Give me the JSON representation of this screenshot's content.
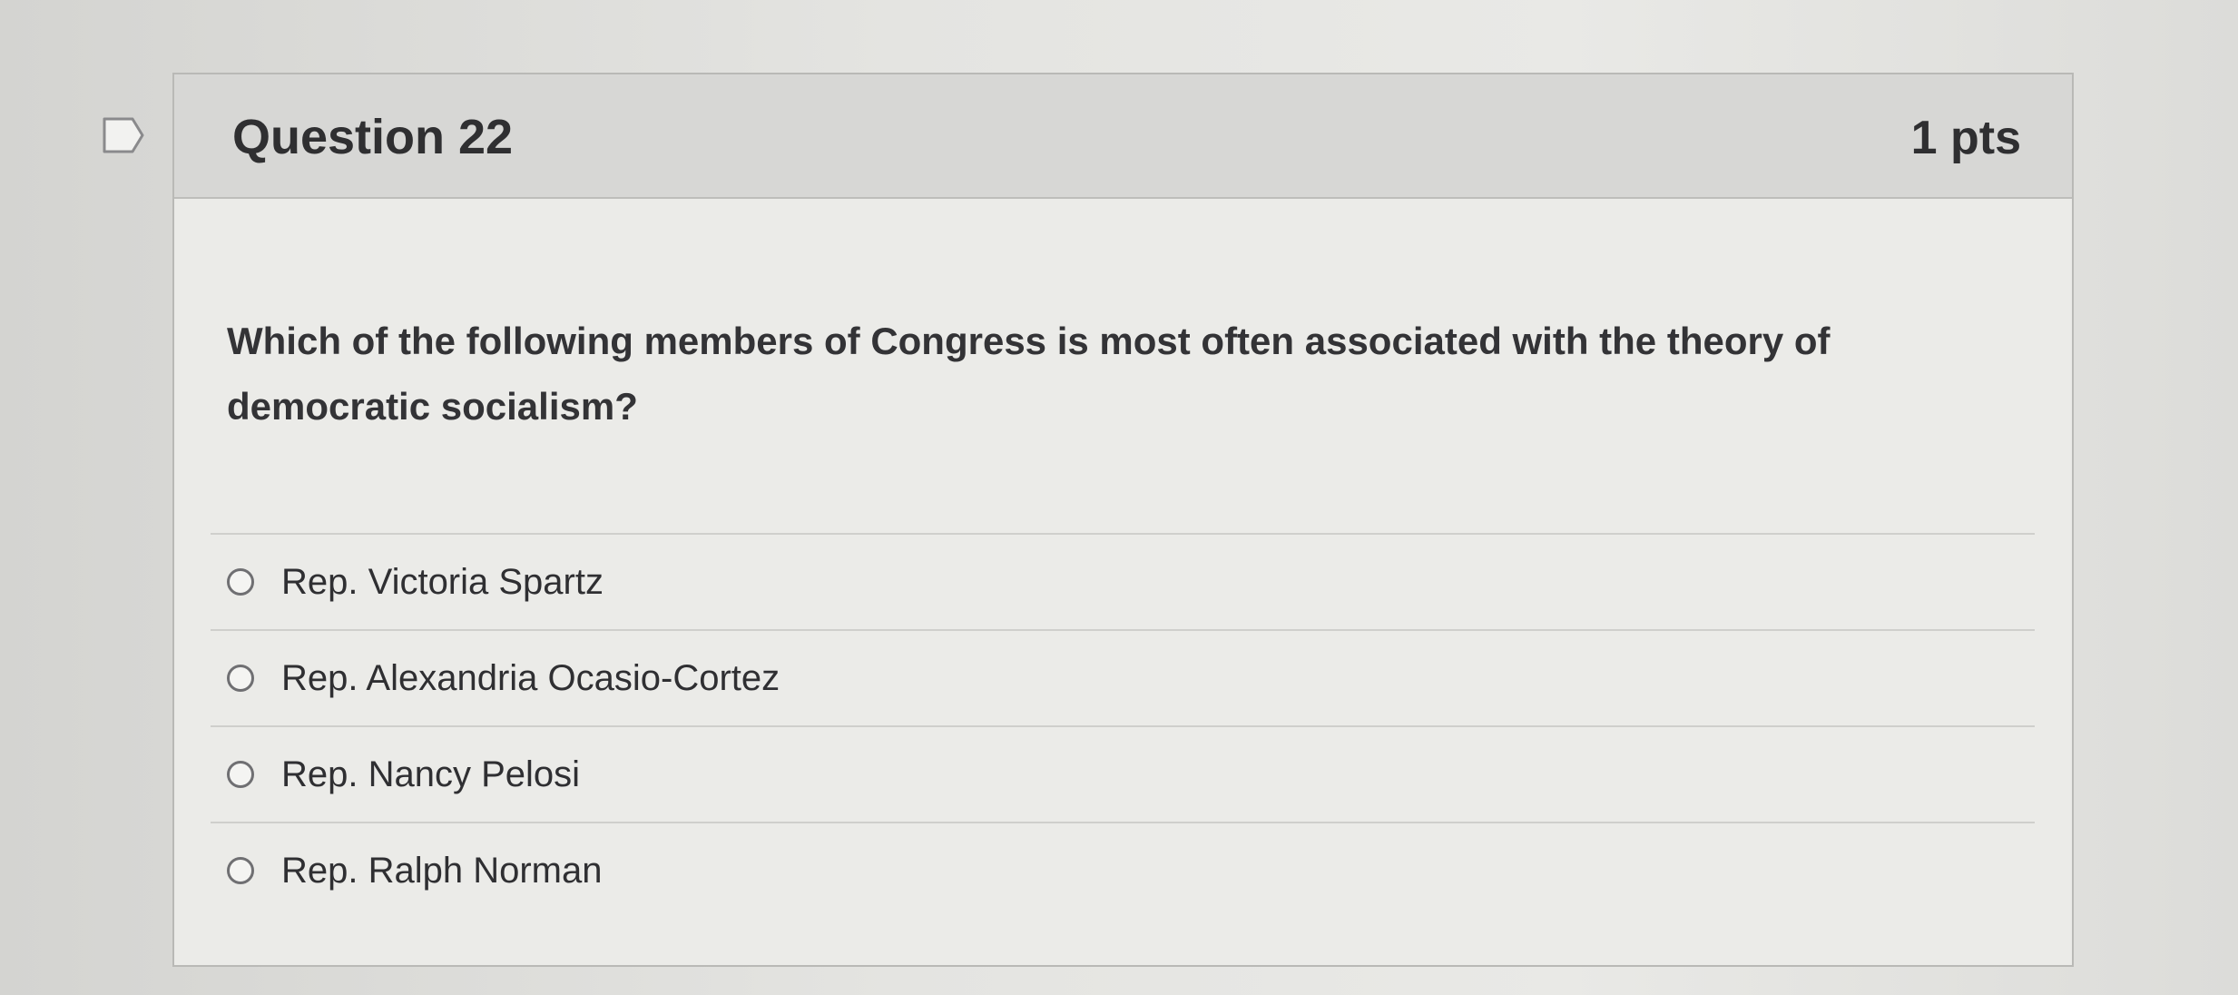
{
  "question": {
    "title": "Question 22",
    "points": "1 pts",
    "text": "Which of the following members of Congress is most often associated with the theory of democratic socialism?"
  },
  "answers": [
    {
      "label": "Rep. Victoria Spartz",
      "selected": false
    },
    {
      "label": "Rep. Alexandria Ocasio-Cortez",
      "selected": false
    },
    {
      "label": "Rep. Nancy Pelosi",
      "selected": false
    },
    {
      "label": "Rep. Ralph Norman",
      "selected": false
    }
  ],
  "icons": {
    "flag": "flag-question-icon",
    "radio": "radio-button-icon"
  },
  "colors": {
    "header_bg": "#d7d7d5",
    "card_bg": "#ebebe8",
    "text": "#2f2f31"
  }
}
